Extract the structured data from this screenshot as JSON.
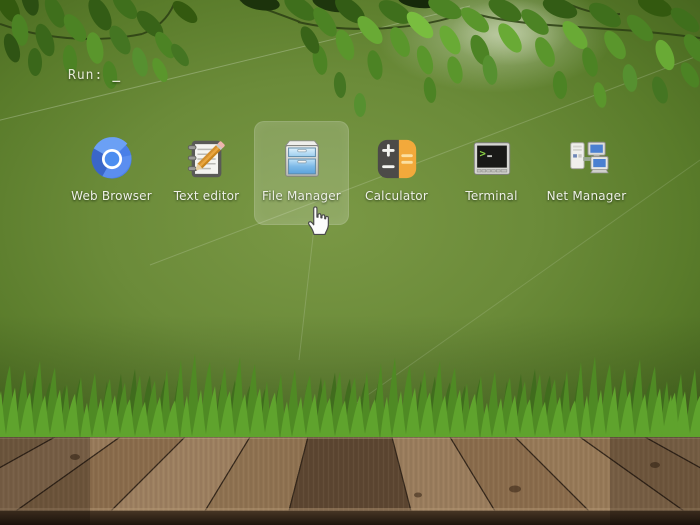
{
  "run_prompt": {
    "label": "Run:",
    "cursor_char": "_"
  },
  "launcher": {
    "items": [
      {
        "label": "Web Browser",
        "icon": "chromium-web-browser",
        "selected": false
      },
      {
        "label": "Text editor",
        "icon": "notepad-pencil",
        "selected": false
      },
      {
        "label": "File Manager",
        "icon": "drawer-cabinet",
        "selected": true
      },
      {
        "label": "Calculator",
        "icon": "calculator",
        "selected": false
      },
      {
        "label": "Terminal",
        "icon": "terminal",
        "selected": false
      },
      {
        "label": "Net Manager",
        "icon": "networked-computers",
        "selected": false
      }
    ]
  },
  "pointer": {
    "type": "hand-pointer"
  },
  "colors": {
    "background_center": "#6b8b39",
    "background_edge": "#38561c",
    "selection_highlight": "rgba(255,255,255,0.17)",
    "label_text": "#eef0e6",
    "run_text": "#e6e9d6",
    "grass_front": "#5fa32d",
    "grass_back": "#477a20",
    "wood_dark_plank": "#5c4631",
    "wood_light_plank": "#977a5a"
  }
}
